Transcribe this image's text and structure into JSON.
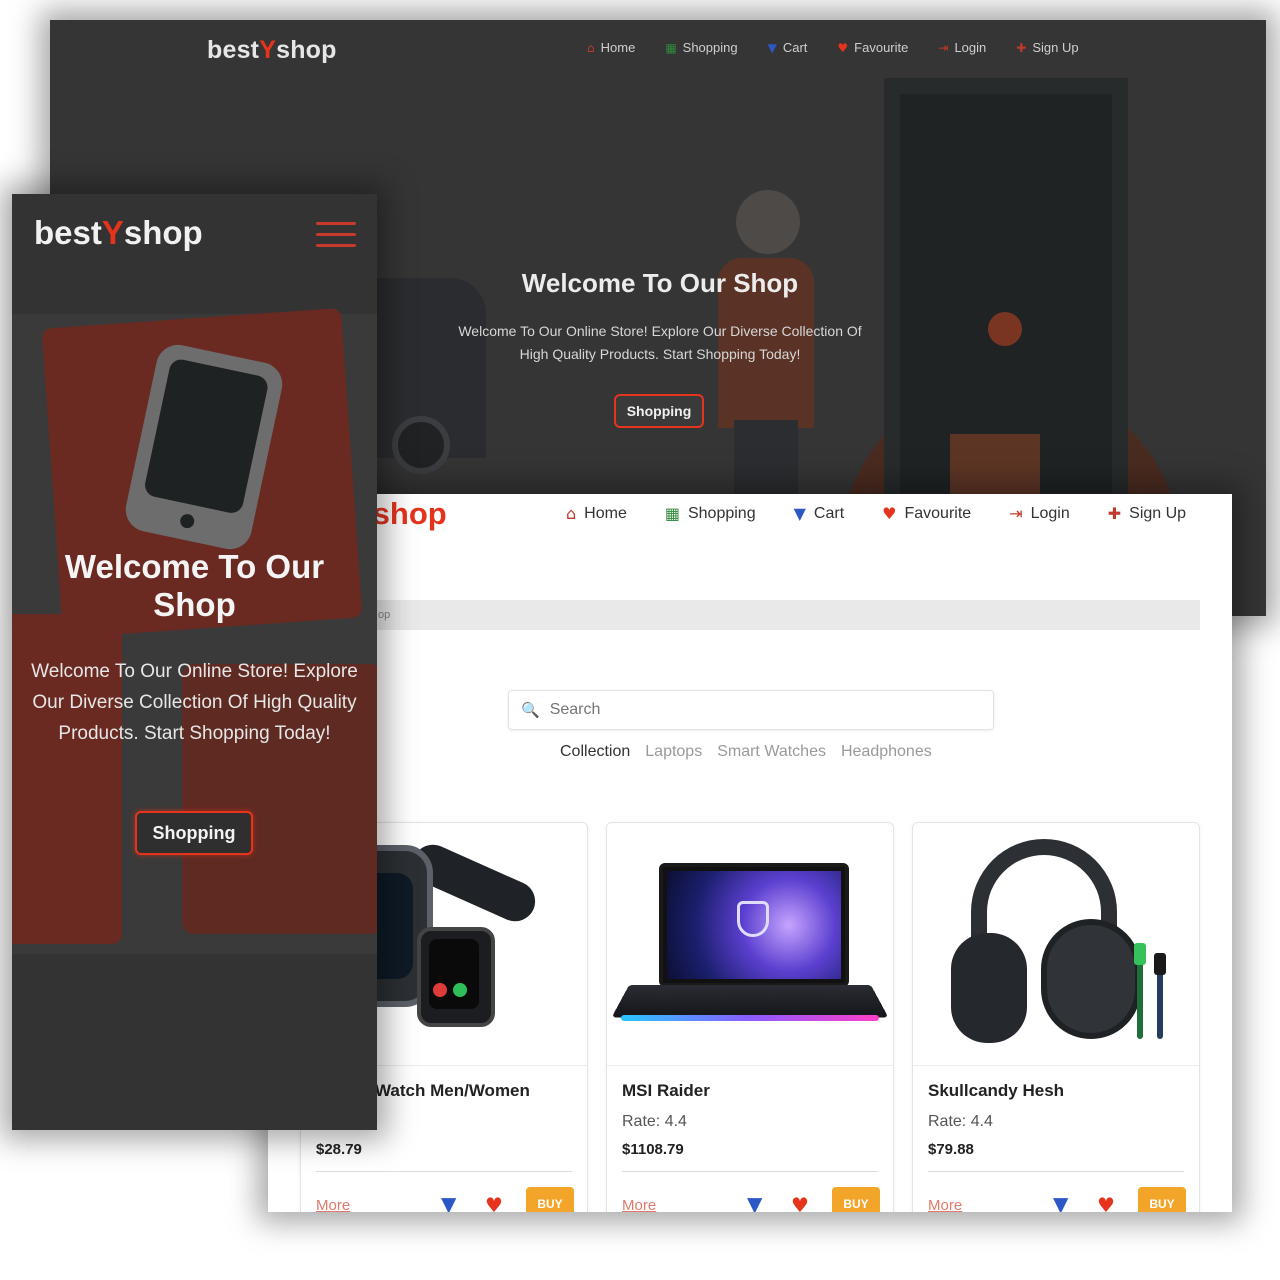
{
  "brand": {
    "part1": "best",
    "accent": "Y",
    "part2": "shop"
  },
  "colors": {
    "accent": "#e5331c",
    "dark_bg": "#353535",
    "buy_button": "#f2a529",
    "cart_icon": "#2b58c5"
  },
  "nav": [
    {
      "label": "Home",
      "icon": "home-icon",
      "glyph": "⌂",
      "color": "#c0392b"
    },
    {
      "label": "Shopping",
      "icon": "store-icon",
      "glyph": "▦",
      "color": "#2e8b3a"
    },
    {
      "label": "Cart",
      "icon": "cart-icon",
      "glyph": "🛒",
      "color": "#2b58c5"
    },
    {
      "label": "Favourite",
      "icon": "heart-icon",
      "glyph": "♥",
      "color": "#e5331c"
    },
    {
      "label": "Login",
      "icon": "login-icon",
      "glyph": "⇥",
      "color": "#c0392b"
    },
    {
      "label": "Sign Up",
      "icon": "user-plus-icon",
      "glyph": "✚",
      "color": "#c0392b"
    }
  ],
  "hero": {
    "title": "Welcome To Our Shop",
    "description": "Welcome To Our Online Store! Explore Our Diverse Collection Of High Quality Products. Start Shopping Today!",
    "button": "Shopping"
  },
  "shop": {
    "brand_visible": "Yshop",
    "breadcrumb": "op",
    "search": {
      "placeholder": "Search",
      "icon": "search-icon"
    },
    "filters": [
      {
        "label": "Collection",
        "active": true
      },
      {
        "label": "Laptops",
        "active": false
      },
      {
        "label": "Smart Watches",
        "active": false
      },
      {
        "label": "Headphones",
        "active": false
      }
    ],
    "products": [
      {
        "name": "Watch Men/Women",
        "rate": "",
        "price": "$28.79",
        "more": "More",
        "buy": "BUY",
        "image": "smart-watch-image"
      },
      {
        "name": "MSI Raider",
        "rate": "Rate: 4.4",
        "price": "$1108.79",
        "more": "More",
        "buy": "BUY",
        "image": "laptop-image"
      },
      {
        "name": "Skullcandy Hesh",
        "rate": "Rate: 4.4",
        "price": "$79.88",
        "more": "More",
        "buy": "BUY",
        "image": "headphones-image"
      }
    ]
  },
  "mobile": {
    "menu_icon": "hamburger-menu-icon",
    "title": "Welcome To Our Shop",
    "description": "Welcome To Our Online Store! Explore Our Diverse Collection Of High Quality Products. Start Shopping Today!",
    "button": "Shopping"
  }
}
